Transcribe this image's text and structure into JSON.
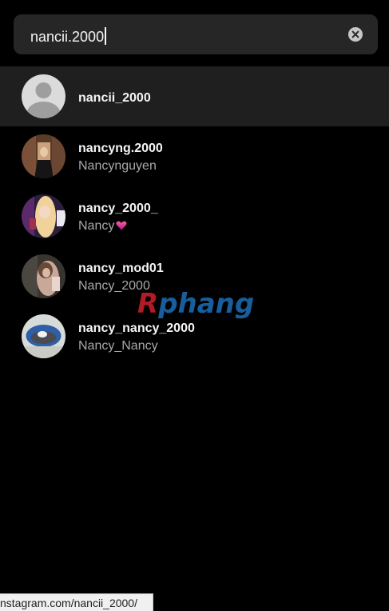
{
  "search": {
    "value": "nancii.2000",
    "clear_icon": "clear-circle-icon"
  },
  "results": [
    {
      "username": "nancii_2000",
      "fullname": "",
      "avatar": "default-avatar"
    },
    {
      "username": "nancyng.2000",
      "fullname": "Nancynguyen",
      "avatar": "photo-avatar"
    },
    {
      "username": "nancy_2000_",
      "fullname": "Nancy",
      "avatar": "photo-avatar",
      "emoji": "pink-heart-emoji"
    },
    {
      "username": "nancy_mod01",
      "fullname": "Nancy_2000",
      "avatar": "photo-avatar"
    },
    {
      "username": "nancy_nancy_2000",
      "fullname": "Nancy_Nancy",
      "avatar": "photo-avatar"
    }
  ],
  "watermark": {
    "first": "R",
    "rest": "phang"
  },
  "status_bar": {
    "url": "nstagram.com/nancii_2000/"
  },
  "colors": {
    "background": "#000000",
    "search_bg": "#262626",
    "active_row": "#1f1f1f",
    "secondary_text": "#a8a8a8"
  }
}
